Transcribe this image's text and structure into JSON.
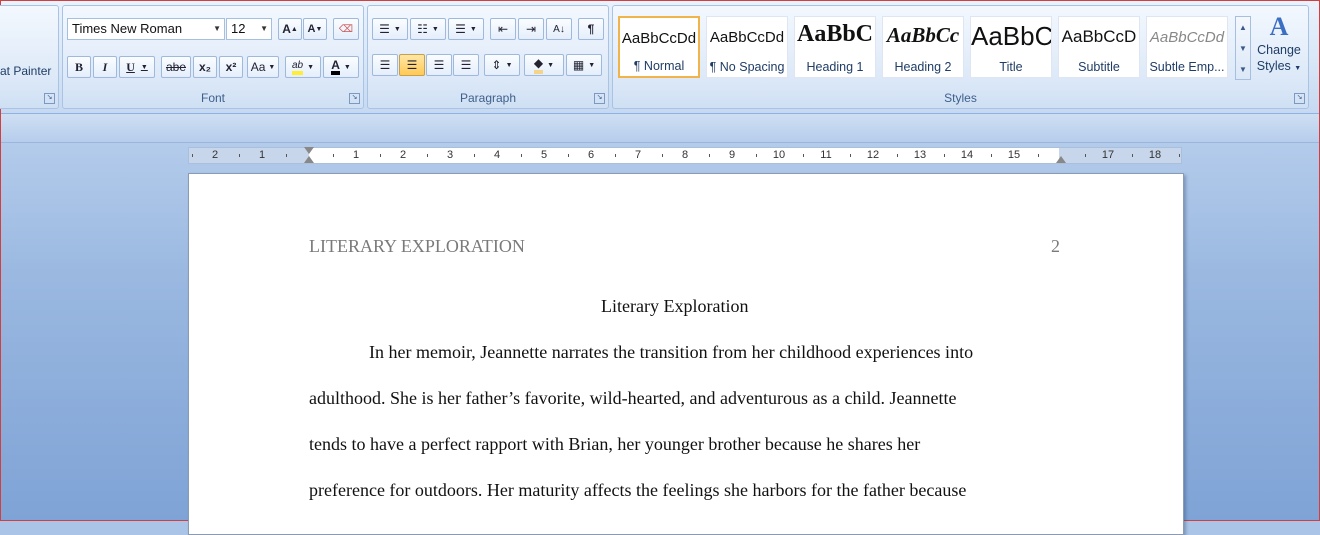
{
  "ribbon": {
    "clipboard": {
      "format_painter_label": "at Painter"
    },
    "font": {
      "group_label": "Font",
      "font_name": "Times New Roman",
      "font_size": "12",
      "grow_font": "A",
      "shrink_font": "A",
      "bold": "B",
      "italic": "I",
      "underline": "U",
      "strikethrough": "abe",
      "subscript": "x₂",
      "superscript": "x²",
      "change_case": "Aa",
      "highlight": "ab",
      "font_color": "A"
    },
    "paragraph": {
      "group_label": "Paragraph",
      "pilcrow": "¶"
    },
    "styles": {
      "group_label": "Styles",
      "items": [
        {
          "sample": "AaBbCcDd",
          "name": "¶ Normal"
        },
        {
          "sample": "AaBbCcDd",
          "name": "¶ No Spacing"
        },
        {
          "sample": "AaBbC",
          "name": "Heading 1"
        },
        {
          "sample": "AaBbCc",
          "name": "Heading 2"
        },
        {
          "sample": "AaBbC",
          "name": "Title"
        },
        {
          "sample": "AaBbCcD",
          "name": "Subtitle"
        },
        {
          "sample": "AaBbCcDd",
          "name": "Subtle Emp..."
        }
      ],
      "change_styles_line1": "Change",
      "change_styles_line2": "Styles"
    }
  },
  "ruler": {
    "numbers": [
      "2",
      "1",
      "1",
      "2",
      "3",
      "4",
      "5",
      "6",
      "7",
      "8",
      "9",
      "10",
      "11",
      "12",
      "13",
      "14",
      "15",
      "17",
      "18"
    ]
  },
  "document": {
    "running_head": "LITERARY EXPLORATION",
    "page_number": "2",
    "title": "Literary Exploration",
    "lines": [
      "In her memoir, Jeannette narrates the transition from her childhood experiences into",
      "adulthood. She is her father’s favorite, wild-hearted, and adventurous as a child. Jeannette",
      "tends to have a perfect rapport with Brian, her younger brother because he shares her",
      "preference for outdoors. Her maturity affects the feelings she harbors for the father because"
    ]
  },
  "colors": {
    "accent": "#f0b44a",
    "ribbon_text": "#1f3d66",
    "frame": "#d04040"
  }
}
